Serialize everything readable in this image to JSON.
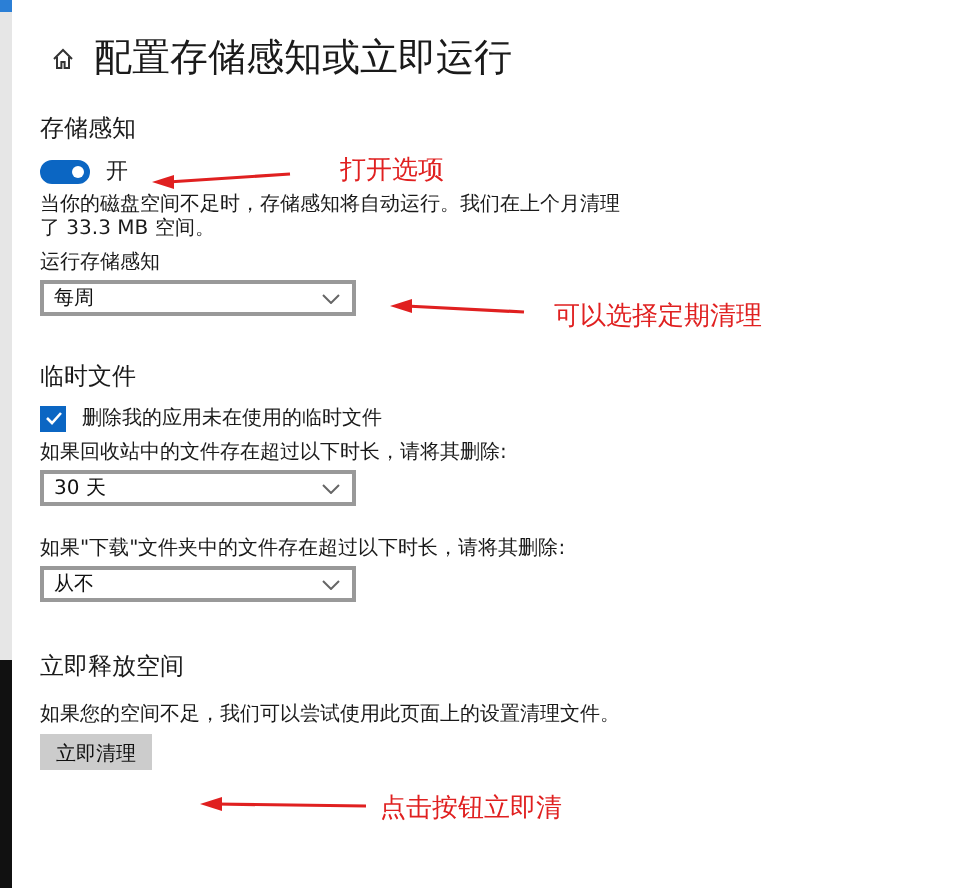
{
  "page_title": "配置存储感知或立即运行",
  "storage_sense": {
    "heading": "存储感知",
    "toggle": {
      "on": true,
      "label": "开"
    },
    "description": "当你的磁盘空间不足时，存储感知将自动运行。我们在上个月清理了 33.3 MB 空间。",
    "run_label": "运行存储感知",
    "run_value": "每周"
  },
  "temp_files": {
    "heading": "临时文件",
    "checkbox": {
      "checked": true,
      "label": "删除我的应用未在使用的临时文件"
    },
    "recycle_label": "如果回收站中的文件存在超过以下时长，请将其删除:",
    "recycle_value": "30 天",
    "downloads_label": "如果\"下载\"文件夹中的文件存在超过以下时长，请将其删除:",
    "downloads_value": "从不"
  },
  "free_space": {
    "heading": "立即释放空间",
    "description": "如果您的空间不足，我们可以尝试使用此页面上的设置清理文件。",
    "button": "立即清理"
  },
  "annotations": [
    {
      "text": "打开选项"
    },
    {
      "text": "可以选择定期清理"
    },
    {
      "text": "点击按钮立即清"
    }
  ]
}
